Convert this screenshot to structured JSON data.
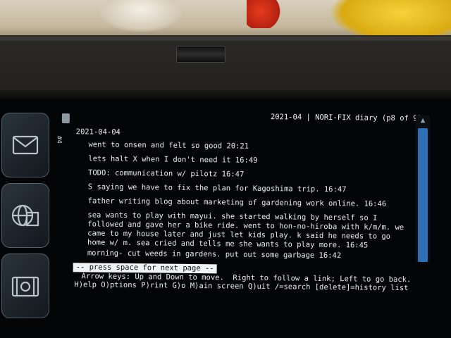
{
  "terminal": {
    "header": "2021-04 | NORI-FIX diary (p8 of 9)",
    "tab_number": "#4",
    "date": "2021-04-04",
    "entries": [
      "went to onsen and felt so good 20:21",
      "lets halt X when I don't need it 16:49",
      "TODO: communication w/ pilotz 16:47",
      "S saying we have to fix the plan for Kagoshima trip. 16:47",
      "father writing blog about marketing of gardening work online. 16:46",
      "sea wants to play with mayui. she started walking by herself so I\nfollowed and gave her a bike ride. went to hon-no-hiroba with k/m/m. we\ncame to my house later and just let kids play. k said he needs to go\nhome w/ m. sea cried and tells me she wants to play more. 16:45",
      "morning- cut weeds in gardens. put out some garbage 16:42"
    ],
    "prompt": "-- press space for next page --",
    "help_line_1": "Arrow keys: Up and Down to move.  Right to follow a link; Left to go back.",
    "help_line_2": "H)elp O)ptions P)rint G)o M)ain screen Q)uit /=search [delete]=history list"
  },
  "dock": {
    "icons": [
      "mail-icon",
      "network-icon",
      "video-icon"
    ]
  },
  "colors": {
    "screen_bg": "#040506",
    "text": "#e8edf1",
    "scroll_thumb": "#2f6fb8"
  }
}
